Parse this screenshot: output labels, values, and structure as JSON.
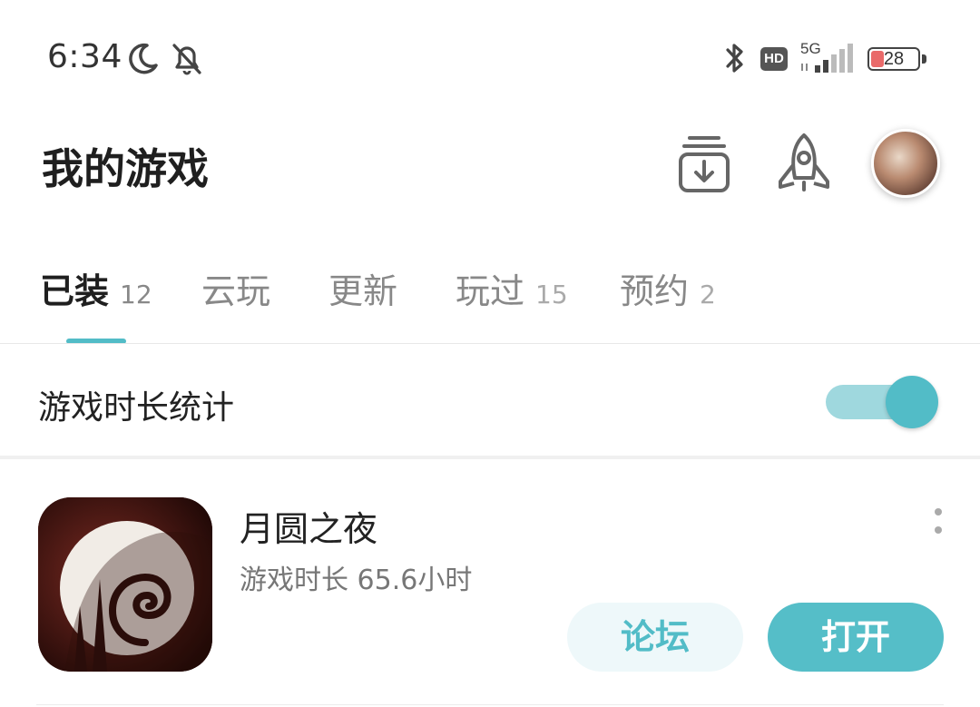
{
  "status_bar": {
    "time": "6:34",
    "network": "5G",
    "hd_badge": "HD",
    "battery": "28",
    "battery_level": 0.28
  },
  "header": {
    "title": "我的游戏"
  },
  "tabs": [
    {
      "label": "已装",
      "count": "12",
      "active": true
    },
    {
      "label": "云玩",
      "count": "",
      "active": false
    },
    {
      "label": "更新",
      "count": "",
      "active": false
    },
    {
      "label": "玩过",
      "count": "15",
      "active": false
    },
    {
      "label": "预约",
      "count": "2",
      "active": false
    }
  ],
  "stats": {
    "label": "游戏时长统计",
    "enabled": true
  },
  "games": [
    {
      "name": "月圆之夜",
      "playtime": "游戏时长 65.6小时",
      "forum_label": "论坛",
      "open_label": "打开"
    }
  ],
  "colors": {
    "accent": "#52bcc7",
    "accent_light": "#eef8fa",
    "toggle_track": "#9fd8de",
    "battery_low": "#e96a6a"
  },
  "icons": {
    "status": [
      "moon-icon",
      "bell-off-icon",
      "bluetooth-icon",
      "signal-icon",
      "battery-icon"
    ],
    "header": [
      "download-manager-icon",
      "rocket-icon",
      "avatar"
    ]
  }
}
